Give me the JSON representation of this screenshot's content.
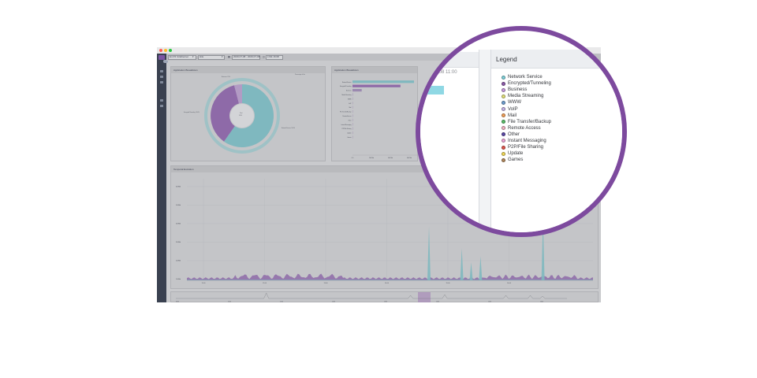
{
  "window": {
    "traffic_lights": [
      "#ff5f57",
      "#febc2e",
      "#28c840"
    ]
  },
  "toolbar": {
    "interface": "En P2 /A Ethernet",
    "source": "Hits",
    "date_range": "2020-07-08 - 2020-07-08",
    "live": "LIVE 16:08"
  },
  "panels": {
    "donut": {
      "title": "Application Breakdown",
      "note": "Percentage of hits",
      "center_label": "Total",
      "center_value": "100%",
      "labels": {
        "left": "Encrypted/Tunneling: 34.6%",
        "right": "Network Service: 53.6%",
        "top": "Business: 3.5%"
      }
    },
    "bars": {
      "title": "Application Breakdown",
      "categories": [
        "Network Service",
        "Encrypted/Tunneling",
        "Business",
        "Media Streaming",
        "WWW",
        "VoIP",
        "Mail",
        "File Transfer/Backup",
        "Remote Access",
        "Other",
        "Instant Messaging",
        "P2P/File Sharing",
        "Update",
        "Games"
      ],
      "values": [
        100,
        78,
        15,
        0.6,
        0.4,
        0.3,
        0.3,
        0.2,
        0.2,
        0.1,
        0.1,
        0.1,
        0.1,
        0.05
      ],
      "x_ticks": [
        "0.0",
        "200 Mb",
        "400 Mb",
        "600 Mb"
      ]
    },
    "temporal": {
      "title": "Temporal Evolution",
      "y_ticks": [
        "600Mb",
        "500Mb",
        "400Mb",
        "300Mb",
        "200Mb",
        "100Mb"
      ],
      "x_ticks": [
        "11:00",
        "12:00",
        "13:00",
        "14:00",
        "15:00",
        "16:00"
      ],
      "nav_ticks": [
        "09:00",
        "10:00",
        "11:00",
        "12:00",
        "13:00",
        "14:00",
        "15:00",
        "16:00"
      ]
    }
  },
  "magnifier": {
    "date_range": "- 2020-07-08 11:00",
    "border_color": "#7d4a9e"
  },
  "legend": {
    "title": "Legend",
    "items": [
      {
        "label": "Network Service",
        "color": "#7fd3dc"
      },
      {
        "label": "Encrypted/Tunneling",
        "color": "#8e5cab"
      },
      {
        "label": "Business",
        "color": "#c99be0"
      },
      {
        "label": "Media Streaming",
        "color": "#e3e07a"
      },
      {
        "label": "WWW",
        "color": "#6f9fd1"
      },
      {
        "label": "VoIP",
        "color": "#c7b4e8"
      },
      {
        "label": "Mail",
        "color": "#f2a05a"
      },
      {
        "label": "File Transfer/Backup",
        "color": "#5cbf6a"
      },
      {
        "label": "Remote Access",
        "color": "#f4b3c4"
      },
      {
        "label": "Other",
        "color": "#5c4aa8"
      },
      {
        "label": "Instant Messaging",
        "color": "#f0a6d8"
      },
      {
        "label": "P2P/File Sharing",
        "color": "#e2574c"
      },
      {
        "label": "Update",
        "color": "#f2d957"
      },
      {
        "label": "Games",
        "color": "#b3895e"
      }
    ]
  },
  "colors": {
    "network_service": "#7fb8bf",
    "encrypted": "#8e6aa8",
    "highlight": "#8fd8e4",
    "sidebar": "#3a4150"
  }
}
